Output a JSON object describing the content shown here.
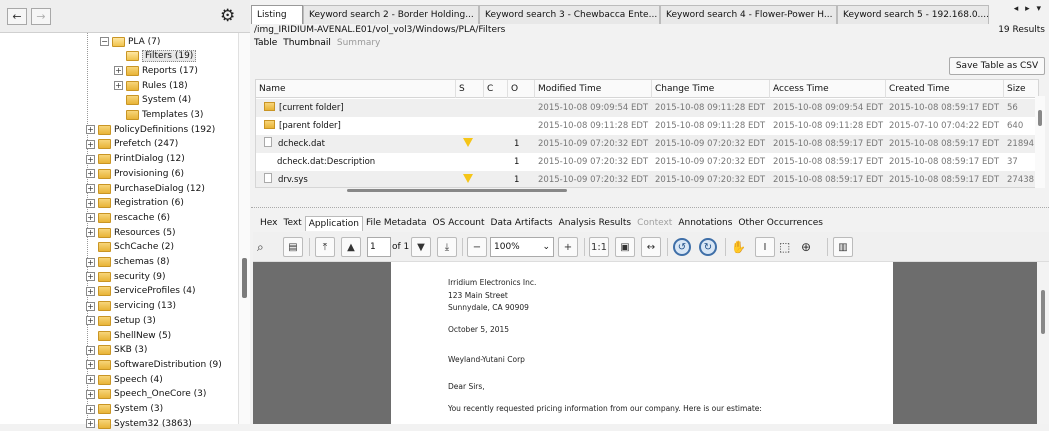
{
  "nav": {
    "back": "←",
    "forward": "→",
    "settings_icon": "gear-icon"
  },
  "tree": [
    {
      "label": "PLA (7)",
      "expander": "−",
      "open": true,
      "indent": 1
    },
    {
      "label": "Filters (19)",
      "expander": "",
      "open": true,
      "selected": true,
      "indent": 2
    },
    {
      "label": "Reports (17)",
      "expander": "+",
      "indent": 2
    },
    {
      "label": "Rules (18)",
      "expander": "+",
      "indent": 2
    },
    {
      "label": "System (4)",
      "expander": "",
      "indent": 2
    },
    {
      "label": "Templates (3)",
      "expander": "",
      "indent": 2
    },
    {
      "label": "PolicyDefinitions (192)",
      "expander": "+",
      "indent": 0
    },
    {
      "label": "Prefetch (247)",
      "expander": "+",
      "indent": 0
    },
    {
      "label": "PrintDialog (12)",
      "expander": "+",
      "indent": 0
    },
    {
      "label": "Provisioning (6)",
      "expander": "+",
      "indent": 0
    },
    {
      "label": "PurchaseDialog (12)",
      "expander": "+",
      "indent": 0
    },
    {
      "label": "Registration (6)",
      "expander": "+",
      "indent": 0
    },
    {
      "label": "rescache (6)",
      "expander": "+",
      "indent": 0
    },
    {
      "label": "Resources (5)",
      "expander": "+",
      "indent": 0
    },
    {
      "label": "SchCache (2)",
      "expander": "",
      "indent": 0
    },
    {
      "label": "schemas (8)",
      "expander": "+",
      "indent": 0
    },
    {
      "label": "security (9)",
      "expander": "+",
      "indent": 0
    },
    {
      "label": "ServiceProfiles (4)",
      "expander": "+",
      "indent": 0
    },
    {
      "label": "servicing (13)",
      "expander": "+",
      "indent": 0
    },
    {
      "label": "Setup (3)",
      "expander": "+",
      "indent": 0
    },
    {
      "label": "ShellNew (5)",
      "expander": "",
      "indent": 0
    },
    {
      "label": "SKB (3)",
      "expander": "+",
      "indent": 0
    },
    {
      "label": "SoftwareDistribution (9)",
      "expander": "+",
      "indent": 0
    },
    {
      "label": "Speech (4)",
      "expander": "+",
      "indent": 0
    },
    {
      "label": "Speech_OneCore (3)",
      "expander": "+",
      "indent": 0
    },
    {
      "label": "System (3)",
      "expander": "+",
      "indent": 0
    },
    {
      "label": "System32 (3863)",
      "expander": "+",
      "indent": 0
    }
  ],
  "tabs": [
    {
      "label": "Listing",
      "active": true,
      "closable": false
    },
    {
      "label": "Keyword search 2 - Border Holding...",
      "closable": true
    },
    {
      "label": "Keyword search 3 - Chewbacca Ente...",
      "closable": true
    },
    {
      "label": "Keyword search 4 - Flower-Power H...",
      "closable": true
    },
    {
      "label": "Keyword search 5 - 192.168.0....",
      "closable": true
    }
  ],
  "tab_nav": "◂ ▸ ▾",
  "path": "/img_IRIDIUM-AVENAL.E01/vol_vol3/Windows/PLA/Filters",
  "results": "19  Results",
  "view_tabs": {
    "table": "Table",
    "thumbnail": "Thumbnail",
    "summary": "Summary"
  },
  "save_csv": "Save Table as CSV",
  "columns": [
    "Name",
    "S",
    "C",
    "O",
    "Modified Time",
    "Change Time",
    "Access Time",
    "Created Time",
    "Size"
  ],
  "rows": [
    {
      "name": "[current folder]",
      "icon": "folder",
      "s": "",
      "c": "",
      "o": "",
      "modified": "2015-10-08 09:09:54 EDT",
      "change": "2015-10-08 09:11:28 EDT",
      "access": "2015-10-08 09:09:54 EDT",
      "created": "2015-10-08 08:59:17 EDT",
      "size": "56"
    },
    {
      "name": "[parent folder]",
      "icon": "folder",
      "s": "",
      "c": "",
      "o": "",
      "modified": "2015-10-08 09:11:28 EDT",
      "change": "2015-10-08 09:11:28 EDT",
      "access": "2015-10-08 09:11:28 EDT",
      "created": "2015-07-10 07:04:22 EDT",
      "size": "640"
    },
    {
      "name": "dcheck.dat",
      "icon": "file",
      "s": "warn",
      "c": "",
      "o": "1",
      "modified": "2015-10-09 07:20:32 EDT",
      "change": "2015-10-09 07:20:32 EDT",
      "access": "2015-10-08 08:59:17 EDT",
      "created": "2015-10-08 08:59:17 EDT",
      "size": "21894"
    },
    {
      "name": "dcheck.dat:Description",
      "icon": "",
      "s": "",
      "c": "",
      "o": "1",
      "modified": "2015-10-09 07:20:32 EDT",
      "change": "2015-10-09 07:20:32 EDT",
      "access": "2015-10-08 08:59:17 EDT",
      "created": "2015-10-08 08:59:17 EDT",
      "size": "37"
    },
    {
      "name": "drv.sys",
      "icon": "file",
      "s": "warn",
      "c": "",
      "o": "1",
      "modified": "2015-10-09 07:20:32 EDT",
      "change": "2015-10-09 07:20:32 EDT",
      "access": "2015-10-08 08:59:17 EDT",
      "created": "2015-10-08 08:59:17 EDT",
      "size": "27438"
    }
  ],
  "detail_tabs": [
    {
      "label": "Hex"
    },
    {
      "label": "Text"
    },
    {
      "label": "Application",
      "active": true
    },
    {
      "label": "File Metadata"
    },
    {
      "label": "OS Account"
    },
    {
      "label": "Data Artifacts"
    },
    {
      "label": "Analysis Results"
    },
    {
      "label": "Context",
      "disabled": true
    },
    {
      "label": "Annotations"
    },
    {
      "label": "Other Occurrences"
    }
  ],
  "toolbar": {
    "page": "1",
    "of_pages": "of 1",
    "zoom": "100%"
  },
  "document": {
    "lines": [
      "Irridium Electronics Inc.",
      "123 Main Street",
      "Sunnydale, CA 90909",
      "October 5, 2015",
      "Weyland-Yutani Corp",
      "Dear Sirs,",
      "You recently requested pricing information from our company. Here is our estimate:"
    ]
  },
  "colors": {
    "folder": "#e8b437",
    "warning": "#f5c518",
    "accent": "#3f6fa8",
    "viewer_bg": "#6d6d6d"
  }
}
